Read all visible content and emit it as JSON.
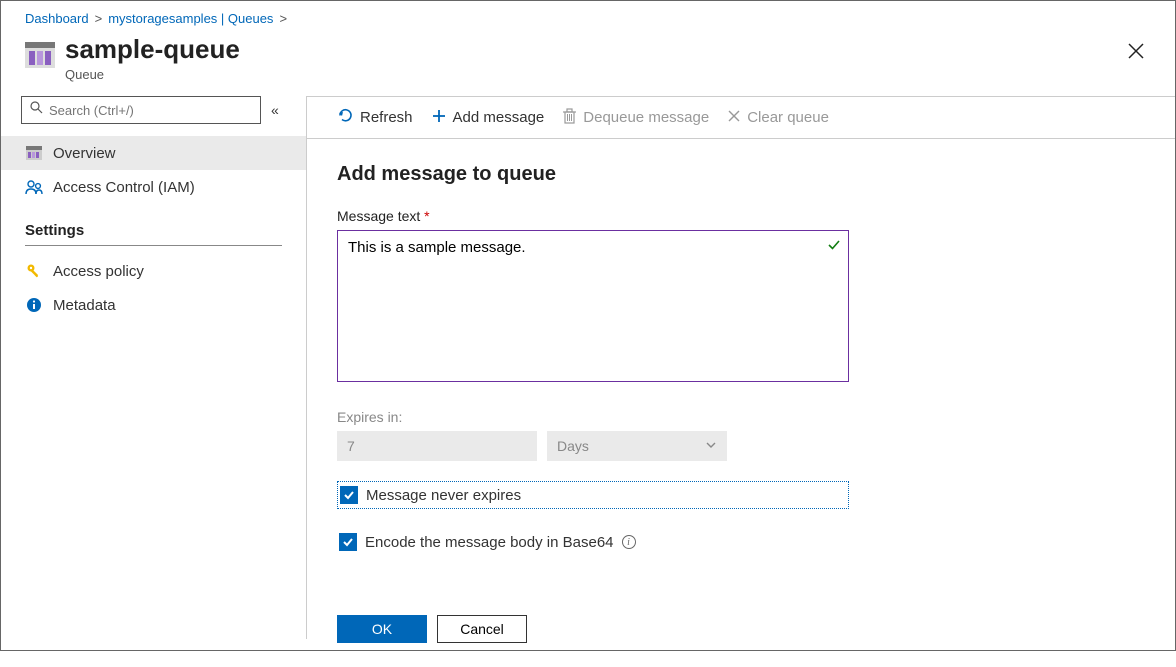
{
  "breadcrumb": {
    "items": [
      "Dashboard",
      "mystoragesamples | Queues"
    ]
  },
  "header": {
    "title": "sample-queue",
    "subtitle": "Queue"
  },
  "sidebar": {
    "search_placeholder": "Search (Ctrl+/)",
    "nav": {
      "overview": "Overview",
      "iam": "Access Control (IAM)"
    },
    "section_settings": "Settings",
    "settings": {
      "access_policy": "Access policy",
      "metadata": "Metadata"
    }
  },
  "toolbar": {
    "refresh": "Refresh",
    "add_message": "Add message",
    "dequeue": "Dequeue message",
    "clear": "Clear queue"
  },
  "form": {
    "title": "Add message to queue",
    "message_label": "Message text",
    "message_value": "This is a sample message.",
    "expires_label": "Expires in:",
    "expires_value": "7",
    "expires_unit": "Days",
    "never_expires_label": "Message never expires",
    "never_expires_checked": true,
    "encode_label": "Encode the message body in Base64",
    "encode_checked": true,
    "ok_label": "OK",
    "cancel_label": "Cancel"
  }
}
